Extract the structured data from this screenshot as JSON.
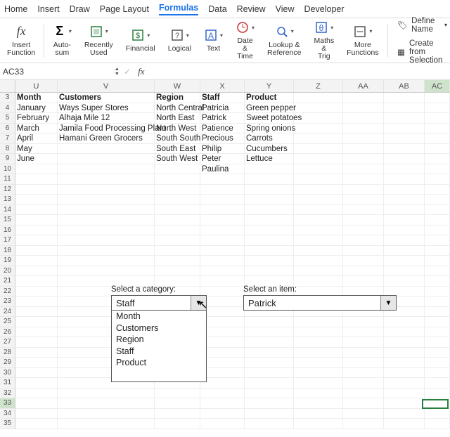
{
  "menu": {
    "items": [
      "Home",
      "Insert",
      "Draw",
      "Page Layout",
      "Formulas",
      "Data",
      "Review",
      "View",
      "Developer"
    ],
    "active": "Formulas"
  },
  "ribbon": {
    "groups": [
      {
        "id": "insert-function",
        "label": "Insert\nFunction"
      },
      {
        "id": "auto-sum",
        "label": "Auto-sum"
      },
      {
        "id": "recently-used",
        "label": "Recently\nUsed"
      },
      {
        "id": "financial",
        "label": "Financial"
      },
      {
        "id": "logical",
        "label": "Logical"
      },
      {
        "id": "text",
        "label": "Text"
      },
      {
        "id": "date-time",
        "label": "Date &\nTime"
      },
      {
        "id": "lookup-reference",
        "label": "Lookup &\nReference"
      },
      {
        "id": "maths-trig",
        "label": "Maths &\nTrig"
      },
      {
        "id": "more-functions",
        "label": "More\nFunctions"
      }
    ],
    "right": {
      "define_name": "Define Name",
      "create_from_selection": "Create from Selection"
    }
  },
  "namebox": {
    "value": "AC33"
  },
  "columns": [
    "U",
    "V",
    "W",
    "X",
    "Y",
    "Z",
    "AA",
    "AB",
    "AC"
  ],
  "row_start": 3,
  "row_end": 35,
  "selected_row": 33,
  "selected_col": "AC",
  "table": {
    "headers": {
      "U": "Month",
      "V": "Customers",
      "W": "Region",
      "X": "Staff",
      "Y": "Product"
    },
    "rows": [
      {
        "U": "January",
        "V": "Ways Super Stores",
        "W": "North Central",
        "X": "Patricia",
        "Y": "Green pepper"
      },
      {
        "U": "February",
        "V": "Alhaja Mile 12",
        "W": "North East",
        "X": "Patrick",
        "Y": "Sweet potatoes"
      },
      {
        "U": "March",
        "V": "Jamila Food Processing Plant",
        "W": "North West",
        "X": "Patience",
        "Y": "Spring onions"
      },
      {
        "U": "April",
        "V": "Hamani Green Grocers",
        "W": "South South",
        "X": "Precious",
        "Y": "Carrots"
      },
      {
        "U": "May",
        "V": "",
        "W": "South East",
        "X": "Philip",
        "Y": "Cucumbers"
      },
      {
        "U": "June",
        "V": "",
        "W": "South West",
        "X": "Peter",
        "Y": "Lettuce"
      },
      {
        "U": "",
        "V": "",
        "W": "",
        "X": "Paulina",
        "Y": ""
      }
    ]
  },
  "controls": {
    "category": {
      "label": "Select a category:",
      "value": "Staff",
      "options": [
        "Month",
        "Customers",
        "Region",
        "Staff",
        "Product"
      ]
    },
    "item": {
      "label": "Select an item:",
      "value": "Patrick"
    }
  }
}
